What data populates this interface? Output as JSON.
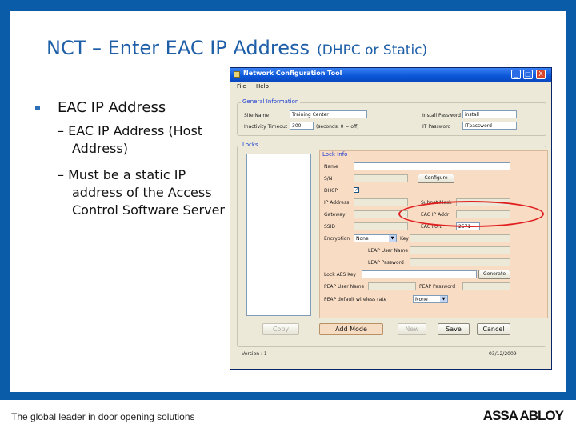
{
  "slide": {
    "title_main": "NCT – Enter EAC IP Address",
    "title_sub": "(DHPC or Static)",
    "bullet1": "EAC IP Address",
    "sub1": "– EAC IP Address (Host Address)",
    "sub2": "– Must be a static IP address of the Access Control Software Server",
    "footer_tagline": "The global leader in door opening solutions",
    "footer_logo": "ASSA ABLOY"
  },
  "window": {
    "title": "Network Configuration Tool",
    "minimize": "_",
    "maximize": "□",
    "close": "X",
    "menu": [
      "File",
      "Help"
    ],
    "general": {
      "label": "General Information",
      "site_name_label": "Site Name",
      "site_name_value": "Training Center",
      "inactivity_label": "Inactivity Timeout",
      "inactivity_value": "300",
      "inactivity_units": "(seconds, 0 = off)",
      "install_pw_label": "Install Password",
      "install_pw_value": "install",
      "it_pw_label": "IT Password",
      "it_pw_value": "ITpassword"
    },
    "locks_label": "Locks",
    "lock_info": {
      "label": "Lock Info",
      "name": "Name",
      "sn": "S/N",
      "configure_btn": "Configure",
      "dhcp": "DHCP",
      "dhcp_checked": "✓",
      "ip_address": "IP Address",
      "subnet_mask": "Subnet Mask",
      "gateway": "Gateway",
      "eac_ip_addr": "EAC IP Addr",
      "ssid": "SSID",
      "eac_port": "EAC Port",
      "eac_port_value": "2571",
      "encryption": "Encryption",
      "encryption_value": "None",
      "key": "Key",
      "leap_user": "LEAP User Name",
      "leap_password": "LEAP Password",
      "lock_aes_key": "Lock AES Key",
      "generate_btn": "Generate",
      "peap_user": "PEAP User Name",
      "peap_password": "PEAP Password",
      "peap_default": "PEAP default wireless rate",
      "peap_default_value": "None"
    },
    "buttons": {
      "copy": "Copy",
      "add_mode": "Add Mode",
      "new": "New",
      "save": "Save",
      "cancel": "Cancel"
    },
    "status": {
      "version": "Version : 1",
      "date": "03/12/2009"
    },
    "colors": {
      "highlight": "#e02020",
      "titlebar": "#0b56d8",
      "lock_info_bg": "#f9dcc4"
    }
  }
}
